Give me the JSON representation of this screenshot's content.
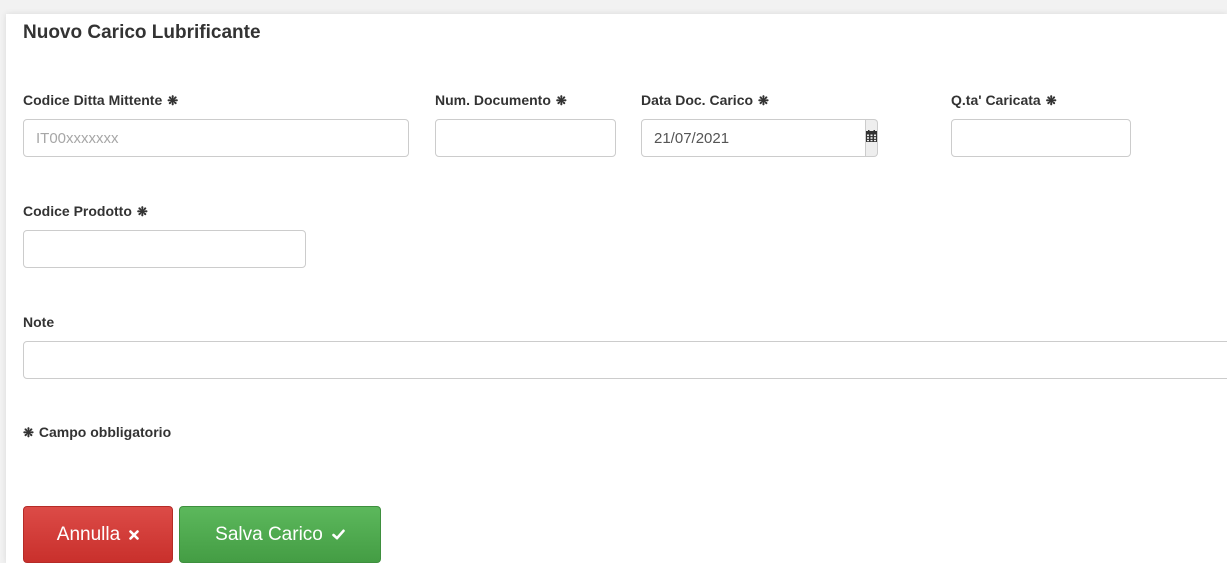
{
  "form": {
    "title": "Nuovo Carico Lubrificante",
    "required_mark": "❋",
    "fields": {
      "codice_ditta": {
        "label": "Codice Ditta Mittente",
        "value": "",
        "placeholder": "IT00xxxxxxx"
      },
      "num_documento": {
        "label": "Num. Documento",
        "value": ""
      },
      "data_doc": {
        "label": "Data Doc. Carico",
        "value": "21/07/2021",
        "icon": "calendar-icon"
      },
      "qta_caricata": {
        "label": "Q.ta' Caricata",
        "value": ""
      },
      "codice_prodotto": {
        "label": "Codice Prodotto",
        "value": ""
      },
      "note": {
        "label": "Note",
        "value": ""
      }
    },
    "legend": "Campo obbligatorio",
    "buttons": {
      "cancel": {
        "label": "Annulla",
        "icon": "times-icon",
        "color": "#d9534f"
      },
      "save": {
        "label": "Salva Carico",
        "icon": "check-icon",
        "color": "#5cb85c"
      }
    }
  }
}
